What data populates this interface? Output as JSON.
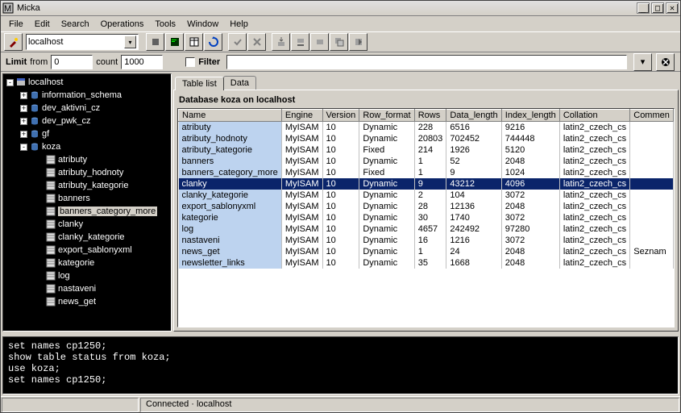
{
  "window": {
    "title": "Micka"
  },
  "menu": {
    "items": [
      "File",
      "Edit",
      "Search",
      "Operations",
      "Tools",
      "Window",
      "Help"
    ]
  },
  "host": {
    "value": "localhost"
  },
  "limits": {
    "limit_label": "Limit",
    "from_label": "from",
    "from_value": "0",
    "count_label": "count",
    "count_value": "1000",
    "filter_label": "Filter",
    "filter_value": ""
  },
  "tree": {
    "root": "localhost",
    "databases": [
      "information_schema",
      "dev_aktivni_cz",
      "dev_pwk_cz",
      "gf",
      "koza"
    ],
    "expanded_db": "koza",
    "tables": [
      "atributy",
      "atributy_hodnoty",
      "atributy_kategorie",
      "banners",
      "banners_category_more",
      "clanky",
      "clanky_kategorie",
      "export_sablonyxml",
      "kategorie",
      "log",
      "nastaveni",
      "news_get"
    ],
    "selected_table": "banners_category_more"
  },
  "tabs": {
    "items": [
      "Table list",
      "Data"
    ],
    "active": 0
  },
  "table": {
    "title": "Database koza on localhost",
    "columns": [
      "Name",
      "Engine",
      "Version",
      "Row_format",
      "Rows",
      "Data_length",
      "Index_length",
      "Collation",
      "Commen"
    ],
    "rows": [
      {
        "n": "atributy",
        "e": "MyISAM",
        "v": "10",
        "r": "Dynamic",
        "rw": "228",
        "dl": "6516",
        "il": "9216",
        "c": "latin2_czech_cs",
        "cm": ""
      },
      {
        "n": "atributy_hodnoty",
        "e": "MyISAM",
        "v": "10",
        "r": "Dynamic",
        "rw": "20803",
        "dl": "702452",
        "il": "744448",
        "c": "latin2_czech_cs",
        "cm": ""
      },
      {
        "n": "atributy_kategorie",
        "e": "MyISAM",
        "v": "10",
        "r": "Fixed",
        "rw": "214",
        "dl": "1926",
        "il": "5120",
        "c": "latin2_czech_cs",
        "cm": ""
      },
      {
        "n": "banners",
        "e": "MyISAM",
        "v": "10",
        "r": "Dynamic",
        "rw": "1",
        "dl": "52",
        "il": "2048",
        "c": "latin2_czech_cs",
        "cm": ""
      },
      {
        "n": "banners_category_more",
        "e": "MyISAM",
        "v": "10",
        "r": "Fixed",
        "rw": "1",
        "dl": "9",
        "il": "1024",
        "c": "latin2_czech_cs",
        "cm": ""
      },
      {
        "n": "clanky",
        "e": "MyISAM",
        "v": "10",
        "r": "Dynamic",
        "rw": "9",
        "dl": "43212",
        "il": "4096",
        "c": "latin2_czech_cs",
        "cm": ""
      },
      {
        "n": "clanky_kategorie",
        "e": "MyISAM",
        "v": "10",
        "r": "Dynamic",
        "rw": "2",
        "dl": "104",
        "il": "3072",
        "c": "latin2_czech_cs",
        "cm": ""
      },
      {
        "n": "export_sablonyxml",
        "e": "MyISAM",
        "v": "10",
        "r": "Dynamic",
        "rw": "28",
        "dl": "12136",
        "il": "2048",
        "c": "latin2_czech_cs",
        "cm": ""
      },
      {
        "n": "kategorie",
        "e": "MyISAM",
        "v": "10",
        "r": "Dynamic",
        "rw": "30",
        "dl": "1740",
        "il": "3072",
        "c": "latin2_czech_cs",
        "cm": ""
      },
      {
        "n": "log",
        "e": "MyISAM",
        "v": "10",
        "r": "Dynamic",
        "rw": "4657",
        "dl": "242492",
        "il": "97280",
        "c": "latin2_czech_cs",
        "cm": ""
      },
      {
        "n": "nastaveni",
        "e": "MyISAM",
        "v": "10",
        "r": "Dynamic",
        "rw": "16",
        "dl": "1216",
        "il": "3072",
        "c": "latin2_czech_cs",
        "cm": ""
      },
      {
        "n": "news_get",
        "e": "MyISAM",
        "v": "10",
        "r": "Dynamic",
        "rw": "1",
        "dl": "24",
        "il": "2048",
        "c": "latin2_czech_cs",
        "cm": "Seznam"
      },
      {
        "n": "newsletter_links",
        "e": "MyISAM",
        "v": "10",
        "r": "Dynamic",
        "rw": "35",
        "dl": "1668",
        "il": "2048",
        "c": "latin2_czech_cs",
        "cm": ""
      }
    ],
    "selected_row": 5
  },
  "console": {
    "lines": [
      "set names cp1250;",
      "show table status from koza;",
      "use koza;",
      "set names cp1250;"
    ]
  },
  "status": {
    "text": "Connected · localhost"
  },
  "icons": {
    "minimize": "_",
    "maximize": "□",
    "close": "✕",
    "dropdown": "▾"
  }
}
